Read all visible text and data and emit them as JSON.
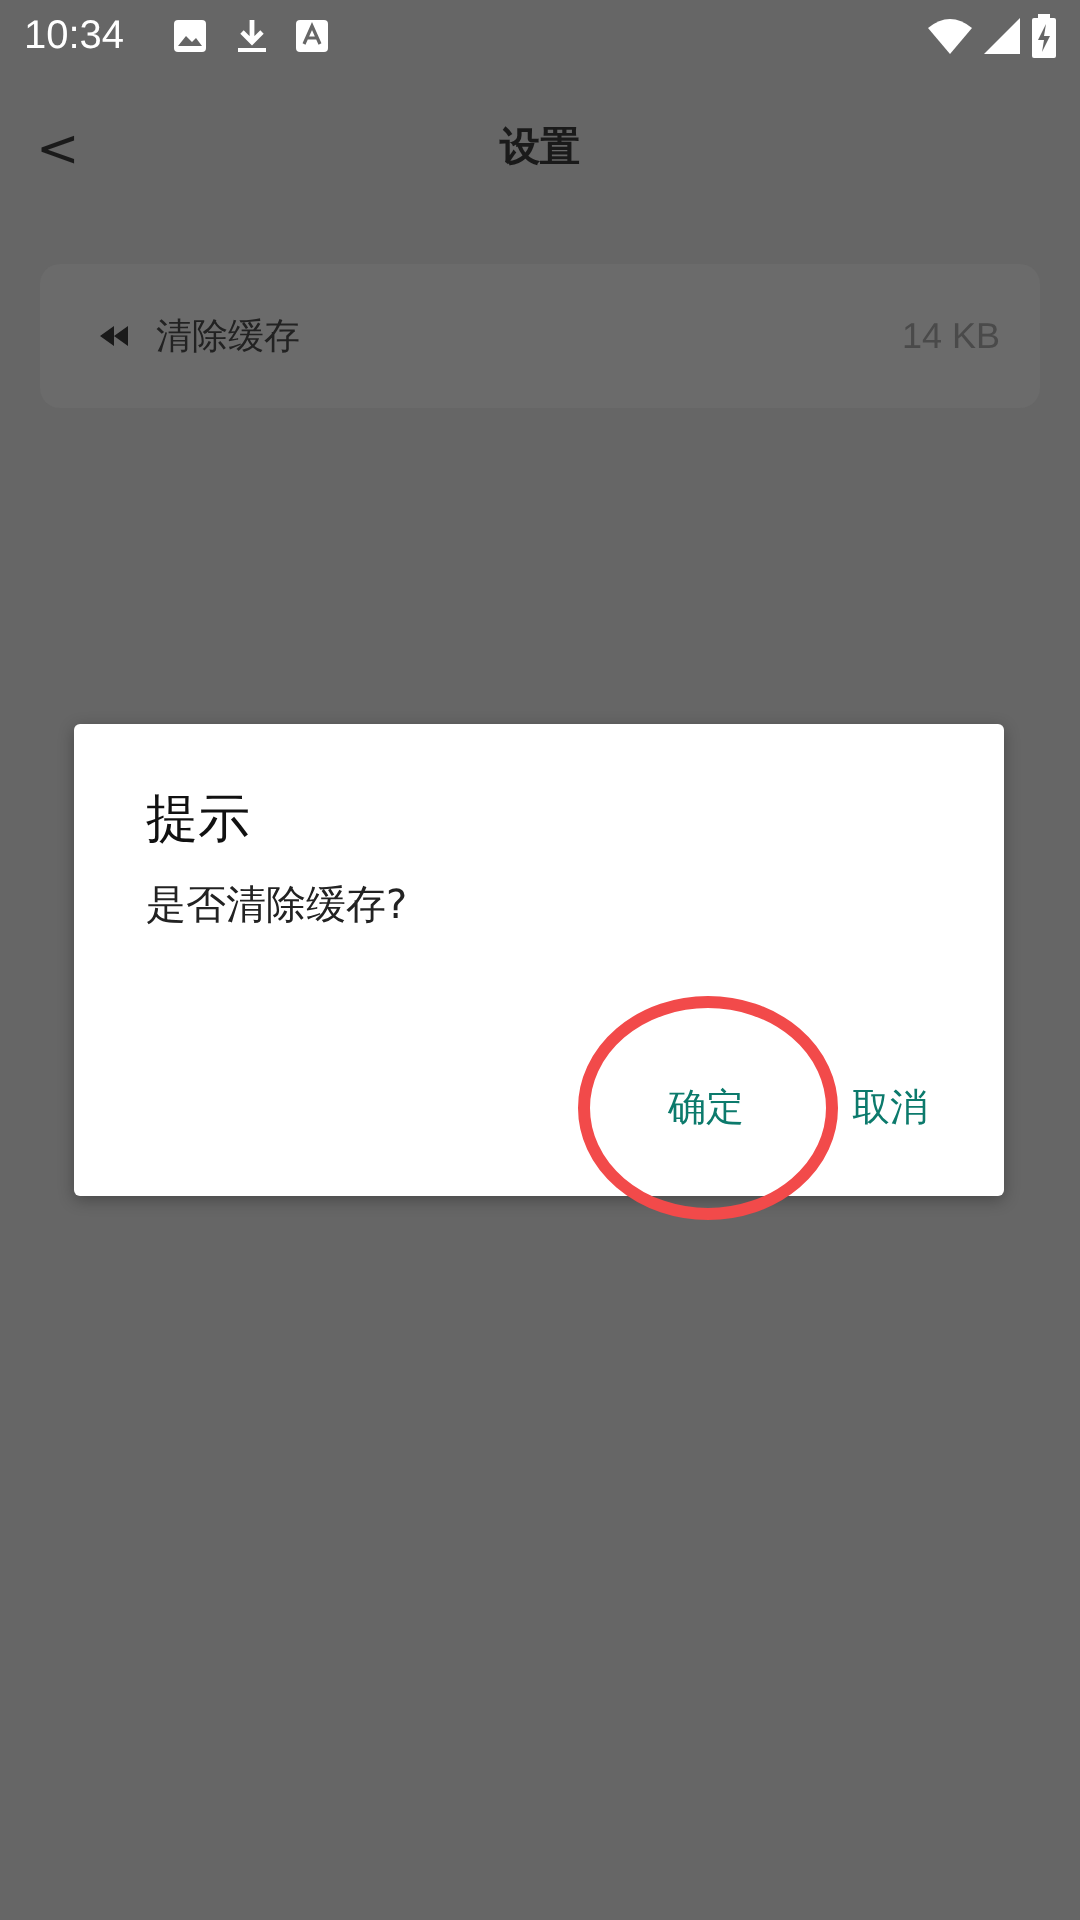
{
  "status_bar": {
    "time": "10:34"
  },
  "header": {
    "back": "<",
    "title": "设置"
  },
  "settings": [
    {
      "label": "清除缓存",
      "value": "14 KB"
    }
  ],
  "dialog": {
    "title": "提示",
    "message": "是否清除缓存?",
    "buttons": [
      {
        "label": "确定",
        "highlighted": true
      },
      {
        "label": "取消",
        "highlighted": false
      }
    ]
  }
}
